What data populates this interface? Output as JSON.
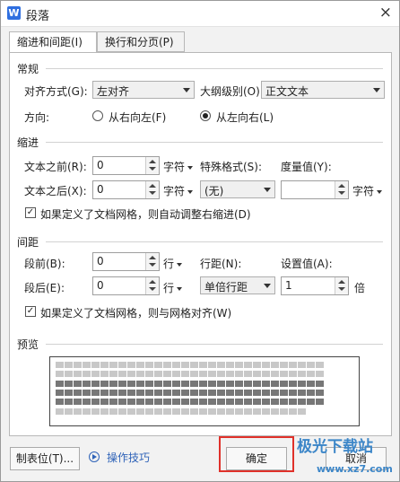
{
  "window": {
    "title": "段落",
    "app_icon": "W",
    "close_symbol": "×"
  },
  "tabs": [
    {
      "label": "缩进和间距(I)"
    },
    {
      "label": "换行和分页(P)"
    }
  ],
  "general": {
    "heading": "常规",
    "alignment_label": "对齐方式(G):",
    "alignment_value": "左对齐",
    "outline_label": "大纲级别(O):",
    "outline_value": "正文文本",
    "direction_label": "方向:",
    "rtl_label": "从右向左(F)",
    "ltr_label": "从左向右(L)"
  },
  "indent": {
    "heading": "缩进",
    "before_label": "文本之前(R):",
    "before_value": "0",
    "before_unit": "字符",
    "after_label": "文本之后(X):",
    "after_value": "0",
    "after_unit": "字符",
    "special_label": "特殊格式(S):",
    "special_value": "(无)",
    "measure_label": "度量值(Y):",
    "measure_value": "",
    "measure_unit": "字符",
    "grid_check_label": "如果定义了文档网格，则自动调整右缩进(D)"
  },
  "spacing": {
    "heading": "间距",
    "before_label": "段前(B):",
    "before_value": "0",
    "before_unit": "行",
    "after_label": "段后(E):",
    "after_value": "0",
    "after_unit": "行",
    "line_label": "行距(N):",
    "line_value": "单倍行距",
    "setting_label": "设置值(A):",
    "setting_value": "1",
    "setting_unit": "倍",
    "grid_check_label": "如果定义了文档网格，则与网格对齐(W)"
  },
  "preview": {
    "heading": "预览"
  },
  "footer": {
    "tabs_button": "制表位(T)...",
    "tips_link": "操作技巧",
    "ok_button": "确定",
    "cancel_button": "取消"
  },
  "watermark": {
    "logo_text": "极光下载站",
    "url_text": "www.xz7.com"
  }
}
